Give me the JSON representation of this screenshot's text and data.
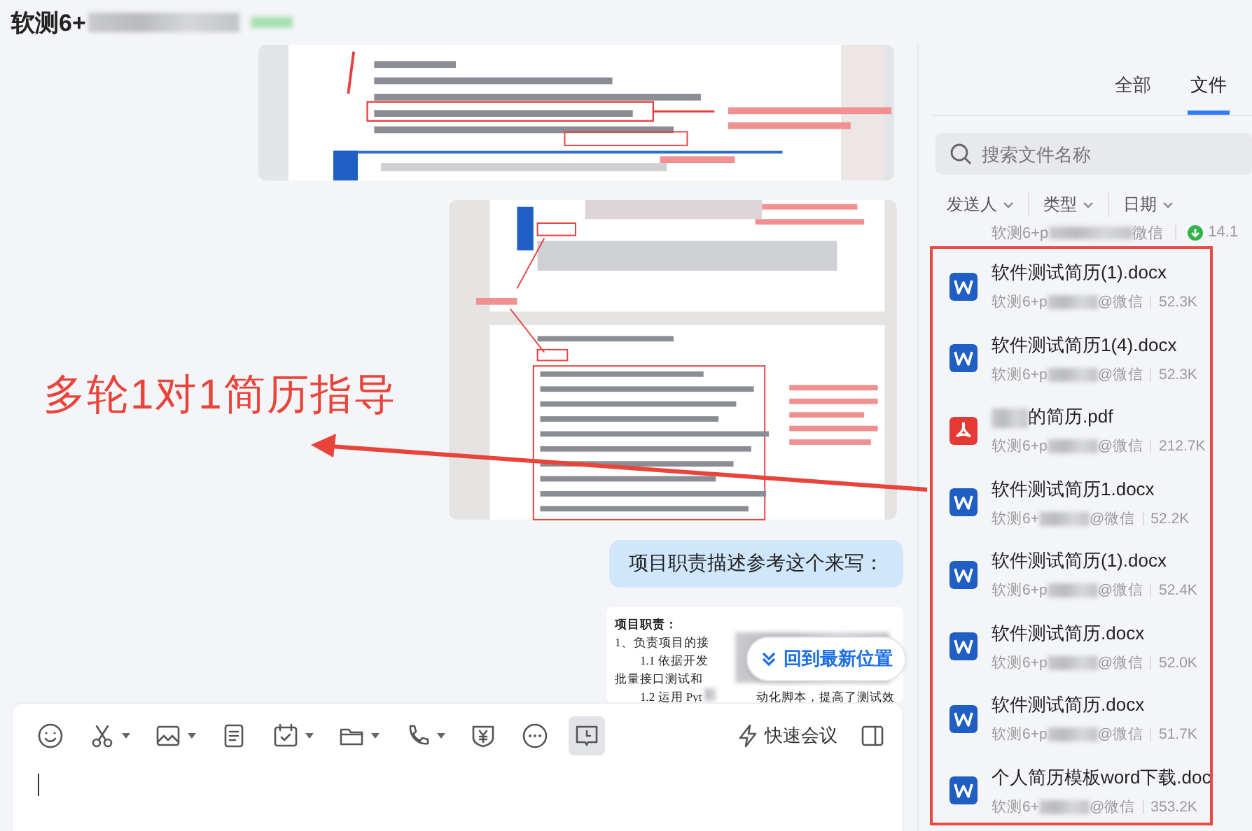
{
  "header": {
    "title": "软测6+"
  },
  "chat": {
    "messages": [
      {
        "kind": "image"
      },
      {
        "kind": "image"
      },
      {
        "kind": "text",
        "text": "项目职责描述参考这个来写："
      },
      {
        "kind": "document",
        "lines": [
          {
            "kind": "heading",
            "text": "项目职责："
          },
          {
            "kind": "item",
            "text": "1、负责项目的接"
          },
          {
            "kind": "subitem",
            "text": "1.1 依据开发"
          },
          {
            "kind": "continuation",
            "text": "批量接口测试和"
          },
          {
            "kind": "subitem",
            "text": "1.2 运用 Pyt",
            "tail": "动化脚本，提高了测试效"
          }
        ]
      }
    ],
    "jump_button": "回到最新位置"
  },
  "composer": {
    "tools": [
      {
        "kind": "emoji",
        "menu": false,
        "selected": false
      },
      {
        "kind": "scissors",
        "menu": true,
        "selected": false
      },
      {
        "kind": "image",
        "menu": true,
        "selected": false
      },
      {
        "kind": "note",
        "menu": false,
        "selected": false
      },
      {
        "kind": "calendar",
        "menu": true,
        "selected": false
      },
      {
        "kind": "folder",
        "menu": true,
        "selected": false
      },
      {
        "kind": "phone",
        "menu": true,
        "selected": false
      },
      {
        "kind": "money",
        "menu": false,
        "selected": false
      },
      {
        "kind": "more",
        "menu": false,
        "selected": false
      },
      {
        "kind": "history",
        "menu": false,
        "selected": true
      }
    ],
    "meeting": "快速会议"
  },
  "files_panel": {
    "tabs": [
      {
        "label": "全部",
        "selected": false
      },
      {
        "label": "文件",
        "selected": true
      }
    ],
    "search": {
      "placeholder": "搜索文件名称"
    },
    "filters": [
      "发送人",
      "类型",
      "日期"
    ],
    "partial_row": {
      "sender": "软测6+p",
      "source": "微信",
      "size": "14.1"
    },
    "files": [
      {
        "kind": "word",
        "name": "软件测试简历(1).docx",
        "sender": "软测6+p",
        "source": "@微信",
        "size": "52.3K"
      },
      {
        "kind": "word",
        "name": "软件测试简历1(4).docx",
        "sender": "软测6+p",
        "source": "@微信",
        "size": "52.3K"
      },
      {
        "kind": "pdf",
        "name": "的简历.pdf",
        "sender": "软测6+p",
        "source": "@微信",
        "size": "212.7K"
      },
      {
        "kind": "word",
        "name": "软件测试简历1.docx",
        "sender": "软测6+",
        "source": "@微信",
        "size": "52.2K"
      },
      {
        "kind": "word",
        "name": "软件测试简历(1).docx",
        "sender": "软测6+p",
        "source": "@微信",
        "size": "52.4K"
      },
      {
        "kind": "word",
        "name": "软件测试简历.docx",
        "sender": "软测6+p",
        "source": "@微信",
        "size": "52.0K"
      },
      {
        "kind": "word",
        "name": "软件测试简历.docx",
        "sender": "软测6+p",
        "source": "@微信",
        "size": "51.7K"
      },
      {
        "kind": "word",
        "name": "个人简历模板word下载.doc",
        "sender": "软测6+",
        "source": "@微信",
        "size": "353.2K"
      }
    ]
  },
  "annotation": {
    "text": "多轮1对1简历指导"
  }
}
